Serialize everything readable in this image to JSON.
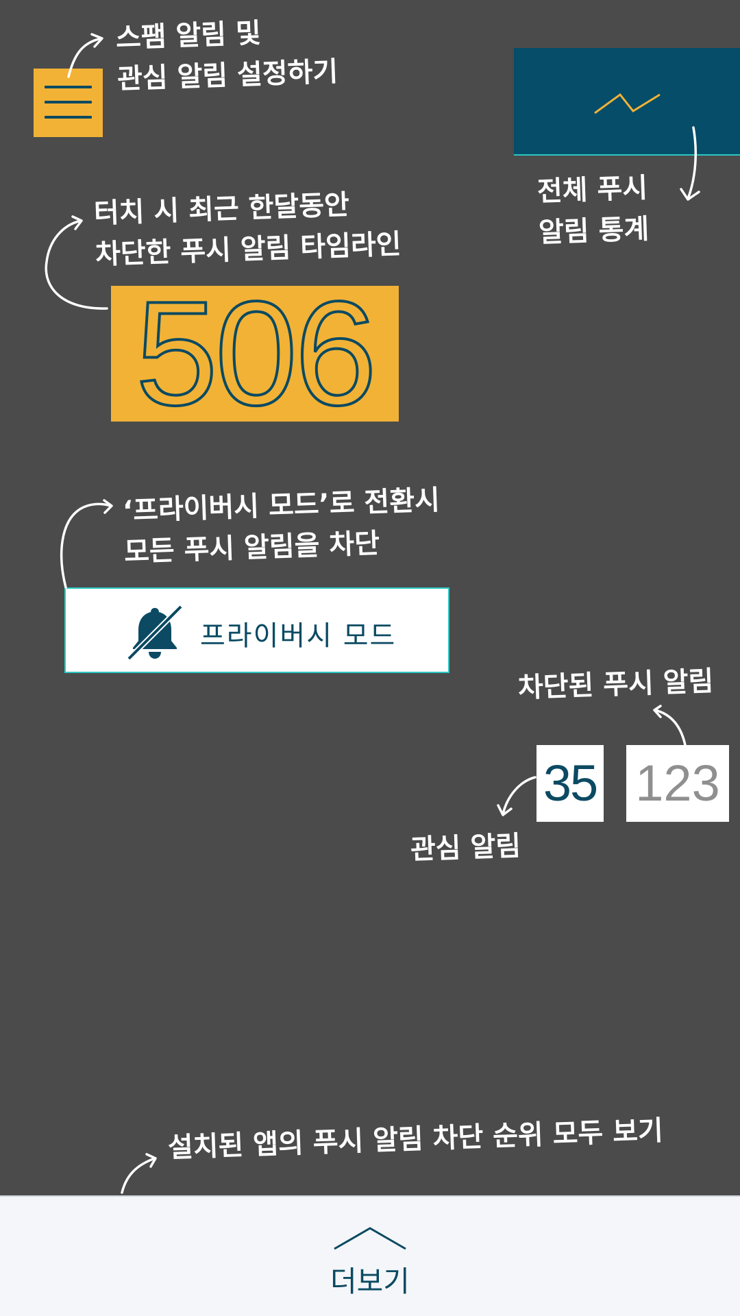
{
  "colors": {
    "background": "#4b4b4b",
    "accent_yellow": "#f2b236",
    "accent_teal": "#054d69",
    "text_dark": "#0b4a62",
    "highlight_cyan": "#2bc8c2",
    "more_bar_bg": "#f4f6f9"
  },
  "coach": {
    "menu_tip": "스팸 알림 및\n관심 알림 설정하기",
    "stats_tip": "전체 푸시\n알림 통계",
    "timeline_tip": "터치 시 최근 한달동안\n차단한 푸시 알림 타임라인",
    "privacy_tip": "‘프라이버시 모드’로 전환시\n모든 푸시 알림을 차단",
    "blocked_tip": "차단된 푸시 알림",
    "interest_tip": "관심 알림",
    "ranking_tip": "설치된 앱의 푸시 알림 차단 순위 모두 보기"
  },
  "menu_button": {
    "icon": "hamburger-menu-icon"
  },
  "stats_button": {
    "icon": "line-chart-icon"
  },
  "blocked_total": {
    "value": "506"
  },
  "privacy_button": {
    "label": "프라이버시 모드",
    "icon": "bell-off-icon"
  },
  "counters": {
    "interest": "35",
    "blocked": "123"
  },
  "more_bar": {
    "label": "더보기",
    "icon": "chevron-up-icon"
  }
}
